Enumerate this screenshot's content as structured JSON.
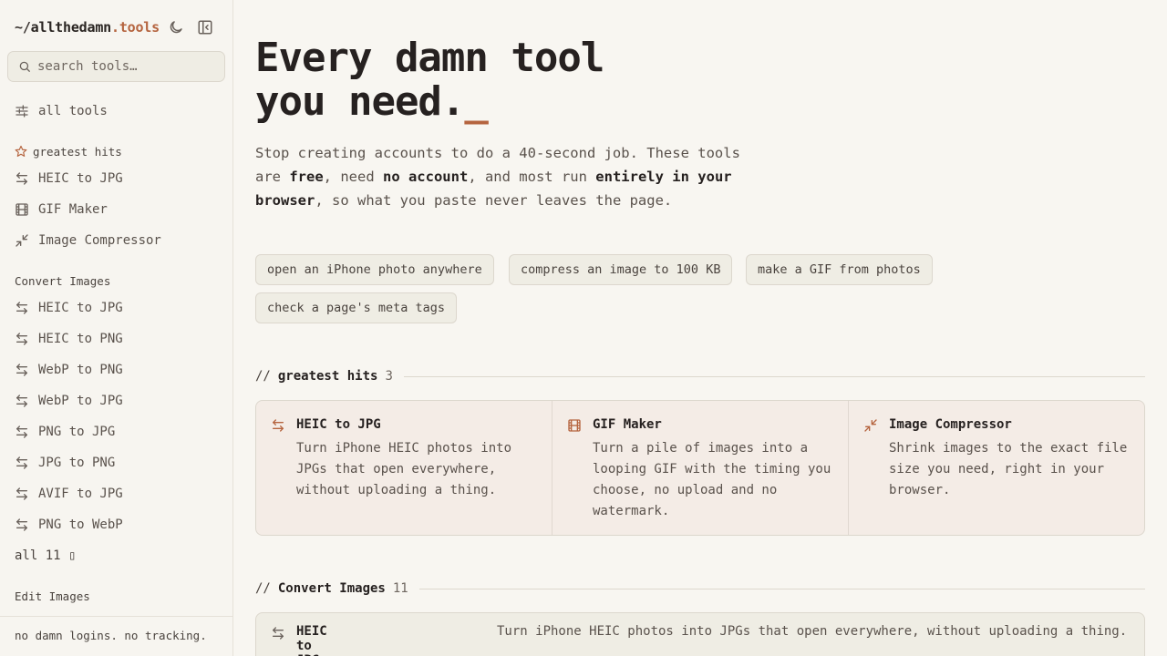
{
  "brand": {
    "prefix": "~/",
    "name": "allthedamn",
    "suffix": ".tools"
  },
  "search": {
    "placeholder": "search tools…"
  },
  "nav": {
    "all_tools": "all tools"
  },
  "sidebar": {
    "greatest_hits": {
      "heading": "greatest hits",
      "icon": "star-icon",
      "items": [
        {
          "label": "HEIC to JPG",
          "icon": "swap-arrows-icon"
        },
        {
          "label": "GIF Maker",
          "icon": "film-icon"
        },
        {
          "label": "Image Compressor",
          "icon": "minimize-icon"
        }
      ]
    },
    "convert_images": {
      "heading": "Convert Images",
      "items": [
        {
          "label": "HEIC to JPG",
          "icon": "swap-arrows-icon"
        },
        {
          "label": "HEIC to PNG",
          "icon": "swap-arrows-icon"
        },
        {
          "label": "WebP to PNG",
          "icon": "swap-arrows-icon"
        },
        {
          "label": "WebP to JPG",
          "icon": "swap-arrows-icon"
        },
        {
          "label": "PNG to JPG",
          "icon": "swap-arrows-icon"
        },
        {
          "label": "JPG to PNG",
          "icon": "swap-arrows-icon"
        },
        {
          "label": "AVIF to JPG",
          "icon": "swap-arrows-icon"
        },
        {
          "label": "PNG to WebP",
          "icon": "swap-arrows-icon"
        }
      ],
      "more": "all 11 ▯"
    },
    "edit_images": {
      "heading": "Edit Images"
    },
    "footer": "no damn logins. no tracking."
  },
  "hero": {
    "title_line1": "Every damn tool",
    "title_line2": "you need.",
    "cursor": "_",
    "desc": {
      "p1": "Stop creating accounts to do a 40-second job. These tools are ",
      "b1": "free",
      "p2": ", need ",
      "b2": "no account",
      "p3": ", and most run ",
      "b3": "entirely in your browser",
      "p4": ", so what you paste never leaves the page."
    },
    "chips": [
      "open an iPhone photo anywhere",
      "compress an image to 100 KB",
      "make a GIF from photos",
      "check a page's meta tags"
    ]
  },
  "sections": {
    "greatest_hits": {
      "slashes": "//",
      "title": "greatest hits",
      "count": "3",
      "cards": [
        {
          "title": "HEIC to JPG",
          "desc": "Turn iPhone HEIC photos into JPGs that open everywhere, without uploading a thing.",
          "icon": "swap-arrows-icon"
        },
        {
          "title": "GIF Maker",
          "desc": "Turn a pile of images into a looping GIF with the timing you choose, no upload and no watermark.",
          "icon": "film-icon"
        },
        {
          "title": "Image Compressor",
          "desc": "Shrink images to the exact file size you need, right in your browser.",
          "icon": "minimize-icon"
        }
      ]
    },
    "convert_images": {
      "slashes": "//",
      "title": "Convert Images",
      "count": "11",
      "rows": [
        {
          "title": "HEIC to JPG",
          "desc": "Turn iPhone HEIC photos into JPGs that open everywhere, without uploading a thing.",
          "icon": "swap-arrows-icon"
        }
      ]
    }
  },
  "colors": {
    "accent": "#b5643f",
    "background": "#f8f6f1",
    "card_bg": "#f4ece6"
  }
}
